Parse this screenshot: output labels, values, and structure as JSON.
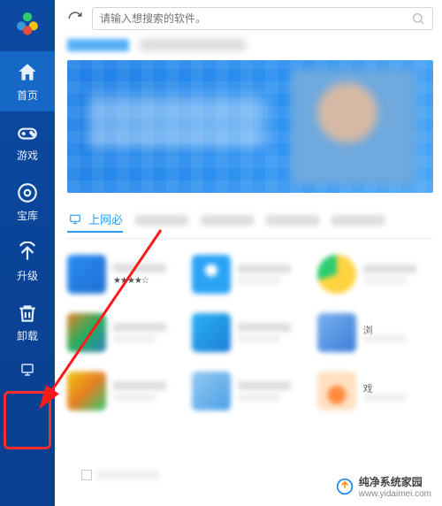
{
  "search": {
    "placeholder": "请输入想搜索的软件。"
  },
  "sidebar": {
    "items": [
      {
        "label": "首页"
      },
      {
        "label": "游戏"
      },
      {
        "label": "宝库"
      },
      {
        "label": "升级"
      },
      {
        "label": "卸载"
      }
    ]
  },
  "tabs": {
    "active_label": "上网必"
  },
  "cards": [
    {
      "label": "浏"
    },
    {
      "label": "戏"
    }
  ],
  "watermark": {
    "brand": "纯净系统家园",
    "url": "www.yidaimei.com"
  }
}
